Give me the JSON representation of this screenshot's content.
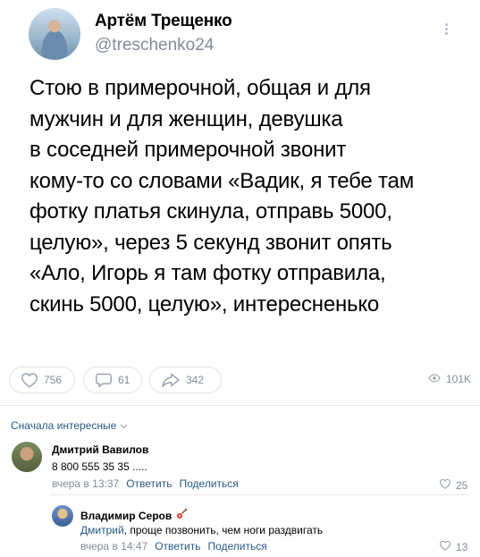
{
  "post": {
    "author_name": "Артём Трещенко",
    "author_handle": "@treschenko24",
    "text_lines": [
      "Стою в примерочной, общая и для",
      "мужчин и для женщин, девушка",
      "в соседней примерочной звонит",
      "кому-то со словами «Вадик, я тебе там",
      "фотку платья скинула, отправь 5000,",
      "целую», через 5 секунд звонит опять",
      "«Ало, Игорь я там фотку отправила,",
      "скинь 5000, целую», интересненько"
    ],
    "likes": "756",
    "comments": "61",
    "shares": "342",
    "views": "101K"
  },
  "comments_section": {
    "sort_label": "Сначала интересные"
  },
  "comments": [
    {
      "name": "Дмитрий Вавилов",
      "text": "8 800 555 35 35 .....",
      "time": "вчера в 13:37",
      "reply_label": "Ответить",
      "share_label": "Поделиться",
      "likes": "25"
    },
    {
      "name": "Владимир Серов",
      "mention": "Дмитрий",
      "text": ", проще позвонить, чем ноги раздвигать",
      "time": "вчера в 14:47",
      "reply_label": "Ответить",
      "share_label": "Поделиться",
      "likes": "13"
    }
  ],
  "colors": {
    "link": "#2a5885",
    "muted": "#818c99",
    "border": "#dce1e6"
  },
  "icons": [
    "more-vertical-icon",
    "heart-icon",
    "comment-icon",
    "share-icon",
    "eye-icon",
    "chevron-down-icon",
    "guitar-icon"
  ]
}
